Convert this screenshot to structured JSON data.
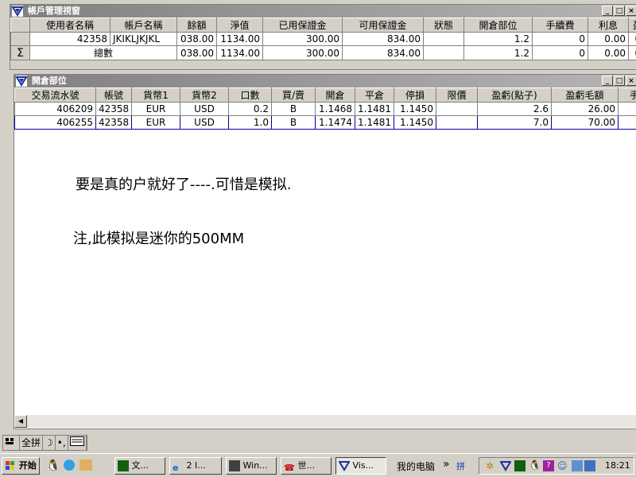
{
  "accounts_window": {
    "title": "帳戶管理視窗",
    "columns": [
      "使用者名稱",
      "帳戶名稱",
      "餘額",
      "淨值",
      "已用保證金",
      "可用保證金",
      "狀態",
      "開倉部位",
      "手續費",
      "利息",
      "盈"
    ],
    "row": [
      "42358",
      "JKIKLJKJKL",
      "038.00",
      "1134.00",
      "300.00",
      "834.00",
      "",
      "1.2",
      "0",
      "0.00",
      "0."
    ],
    "summary_marker": "Σ",
    "summary": [
      "總數",
      "038.00",
      "1134.00",
      "300.00",
      "834.00",
      "",
      "1.2",
      "0",
      "0.00",
      "0."
    ]
  },
  "positions_window": {
    "title": "開倉部位",
    "columns": [
      "交易流水號",
      "帳號",
      "貨幣1",
      "貨幣2",
      "口數",
      "買/賣",
      "開倉",
      "平倉",
      "停損",
      "限價",
      "盈虧(點子)",
      "盈虧毛額",
      "手"
    ],
    "rows": [
      [
        "406209",
        "42358",
        "EUR",
        "USD",
        "0.2",
        "B",
        "1.1468",
        "1.1481",
        "1.1450",
        "",
        "2.6",
        "26.00",
        ""
      ],
      [
        "406255",
        "42358",
        "EUR",
        "USD",
        "1.0",
        "B",
        "1.1474",
        "1.1481",
        "1.1450",
        "",
        "7.0",
        "70.00",
        ""
      ]
    ]
  },
  "notes": {
    "line1": "要是真的户就好了----.可惜是模拟.",
    "line2": "注,此模拟是迷你的500MM"
  },
  "ime": {
    "mode": "全拼"
  },
  "taskbar": {
    "start": "开始",
    "tasks": [
      "文...",
      "2 I...",
      "Win...",
      "世...",
      "Vis..."
    ],
    "desktop_label": "我的电脑",
    "clock": "18:21"
  },
  "colors": {
    "titlebar": "#808080",
    "selection": "#0000a0",
    "face": "#d4d0c8"
  }
}
